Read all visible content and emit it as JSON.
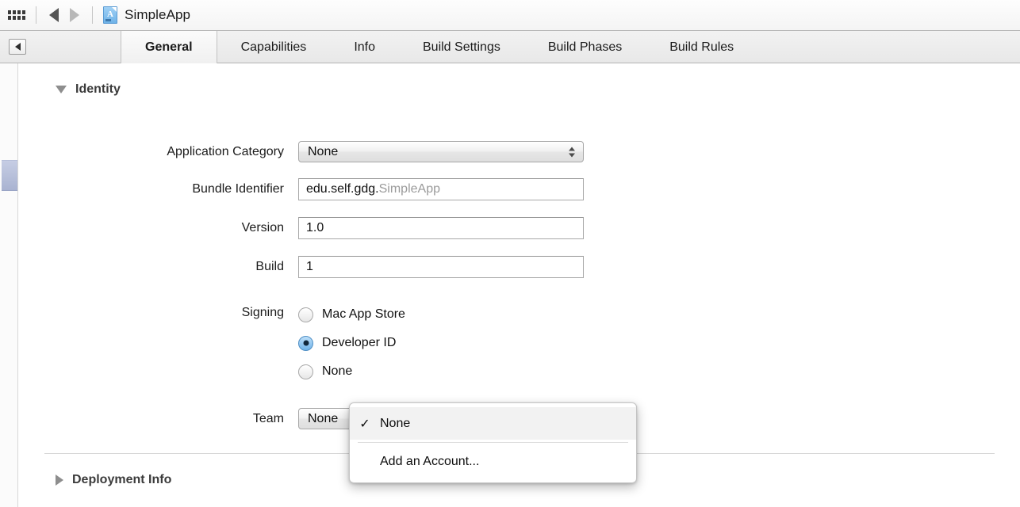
{
  "toolbar": {
    "grid_icon": "grid-icon",
    "back_icon": "back-arrow-icon",
    "forward_icon": "forward-arrow-icon",
    "file_icon": "app-document-icon",
    "document_title": "SimpleApp"
  },
  "tabbar": {
    "collapse_button_icon": "collapse-left-icon",
    "tabs": [
      {
        "label": "General",
        "selected": true
      },
      {
        "label": "Capabilities",
        "selected": false
      },
      {
        "label": "Info",
        "selected": false
      },
      {
        "label": "Build Settings",
        "selected": false
      },
      {
        "label": "Build Phases",
        "selected": false
      },
      {
        "label": "Build Rules",
        "selected": false
      }
    ]
  },
  "sections": {
    "identity": {
      "title": "Identity",
      "expanded": true,
      "disclosure_icon": "disclosure-triangle-down-icon",
      "application_category": {
        "label": "Application Category",
        "value": "None",
        "stepper_icon": "updown-stepper-icon"
      },
      "bundle_identifier": {
        "label": "Bundle Identifier",
        "value_prefix": "edu.self.gdg.",
        "value_suffix": "SimpleApp"
      },
      "version": {
        "label": "Version",
        "value": "1.0",
        "placeholder": "1.0"
      },
      "build": {
        "label": "Build",
        "value": "1",
        "placeholder": "1"
      },
      "signing": {
        "label": "Signing",
        "options": [
          {
            "label": "Mac App Store",
            "selected": false
          },
          {
            "label": "Developer ID",
            "selected": true
          },
          {
            "label": "None",
            "selected": false
          }
        ]
      },
      "team": {
        "label": "Team",
        "value": "None"
      }
    },
    "deployment_info": {
      "title": "Deployment Info",
      "expanded": false,
      "disclosure_icon": "disclosure-triangle-right-icon"
    }
  },
  "menu": {
    "open": true,
    "check_glyph": "✓",
    "items": [
      {
        "label": "None",
        "checked": true
      },
      {
        "label": "Add an Account...",
        "checked": false
      }
    ]
  },
  "scrollbar": {
    "thumb_name": "vertical-scrollbar-thumb"
  },
  "colors": {
    "selection_blue": "#6fb2e8",
    "scroll_thumb": "#a9b3d1",
    "text": "#111111",
    "dim_text": "#9b9b9b"
  }
}
